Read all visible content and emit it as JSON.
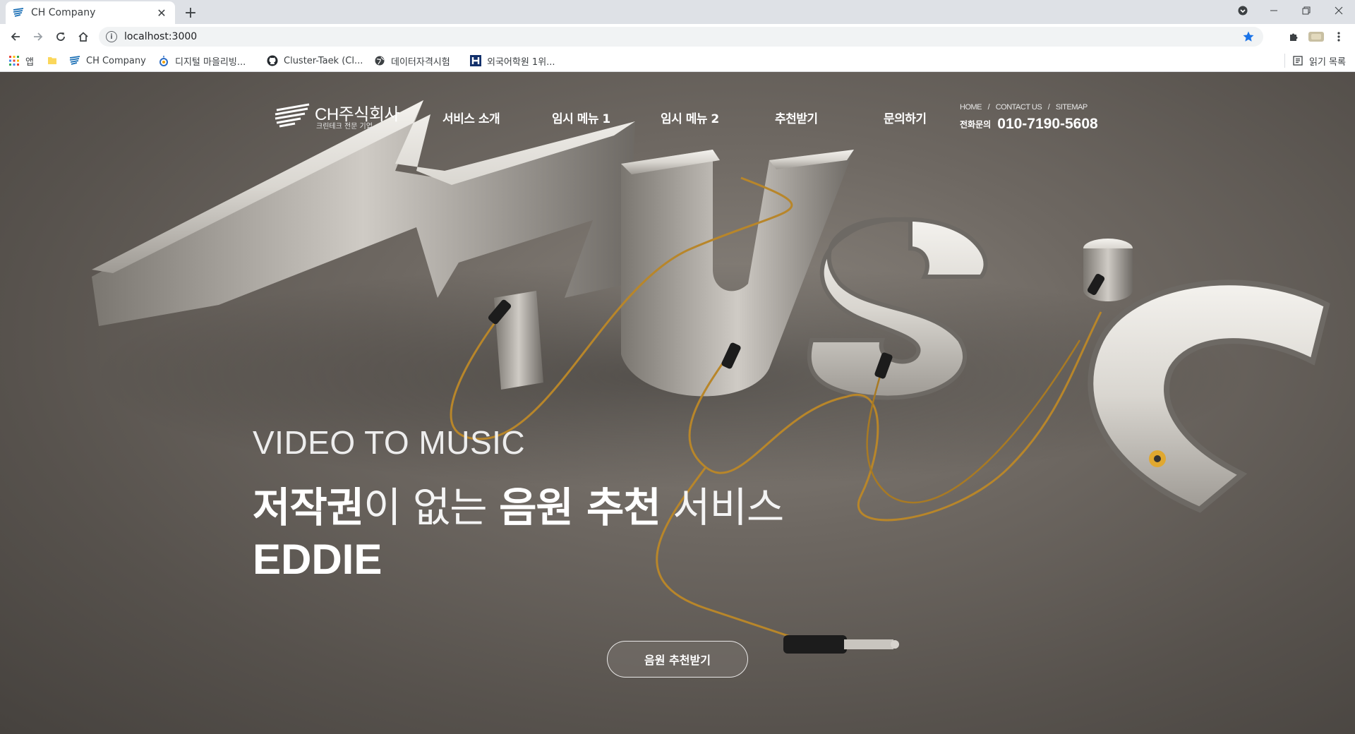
{
  "browser": {
    "tab_title": "CH Company",
    "url": "localhost:3000",
    "bookmarks": [
      {
        "label": "앱",
        "icon": "apps-grid-icon"
      },
      {
        "label": "",
        "icon": "folder-icon"
      },
      {
        "label": "CH Company",
        "icon": "ch-company-icon"
      },
      {
        "label": "디지털 마을리빙...",
        "icon": "digital-village-icon"
      },
      {
        "label": "Cluster-Taek (Cl...",
        "icon": "github-icon"
      },
      {
        "label": "데이터자격시험",
        "icon": "globe-icon"
      },
      {
        "label": "외국어학원 1위...",
        "icon": "hackers-icon"
      }
    ],
    "reading_list": "읽기 목록"
  },
  "header": {
    "logo_name": "CH주식회사",
    "logo_sub": "크린테크 전문 기업",
    "nav": [
      "서비스 소개",
      "임시 메뉴 1",
      "임시 메뉴 2",
      "추천받기",
      "문의하기"
    ],
    "util_links": [
      "HOME",
      "CONTACT US",
      "SITEMAP"
    ],
    "util_sep": "/",
    "phone_label": "전화문의",
    "phone_number": "010-7190-5608"
  },
  "hero": {
    "title_en": "VIDEO TO MUSIC",
    "title_ko_parts": [
      {
        "text": "저작권",
        "style": "b"
      },
      {
        "text": "이 없는 ",
        "style": "l"
      },
      {
        "text": "음원 추천",
        "style": "b"
      },
      {
        "text": " 서비스",
        "style": "l"
      }
    ],
    "brand": "EDDIE",
    "cta_label": "음원 추천받기"
  },
  "colors": {
    "accent_star": "#1a73e8",
    "chrome_bg": "#dee1e6",
    "hero_text": "#ffffff"
  }
}
